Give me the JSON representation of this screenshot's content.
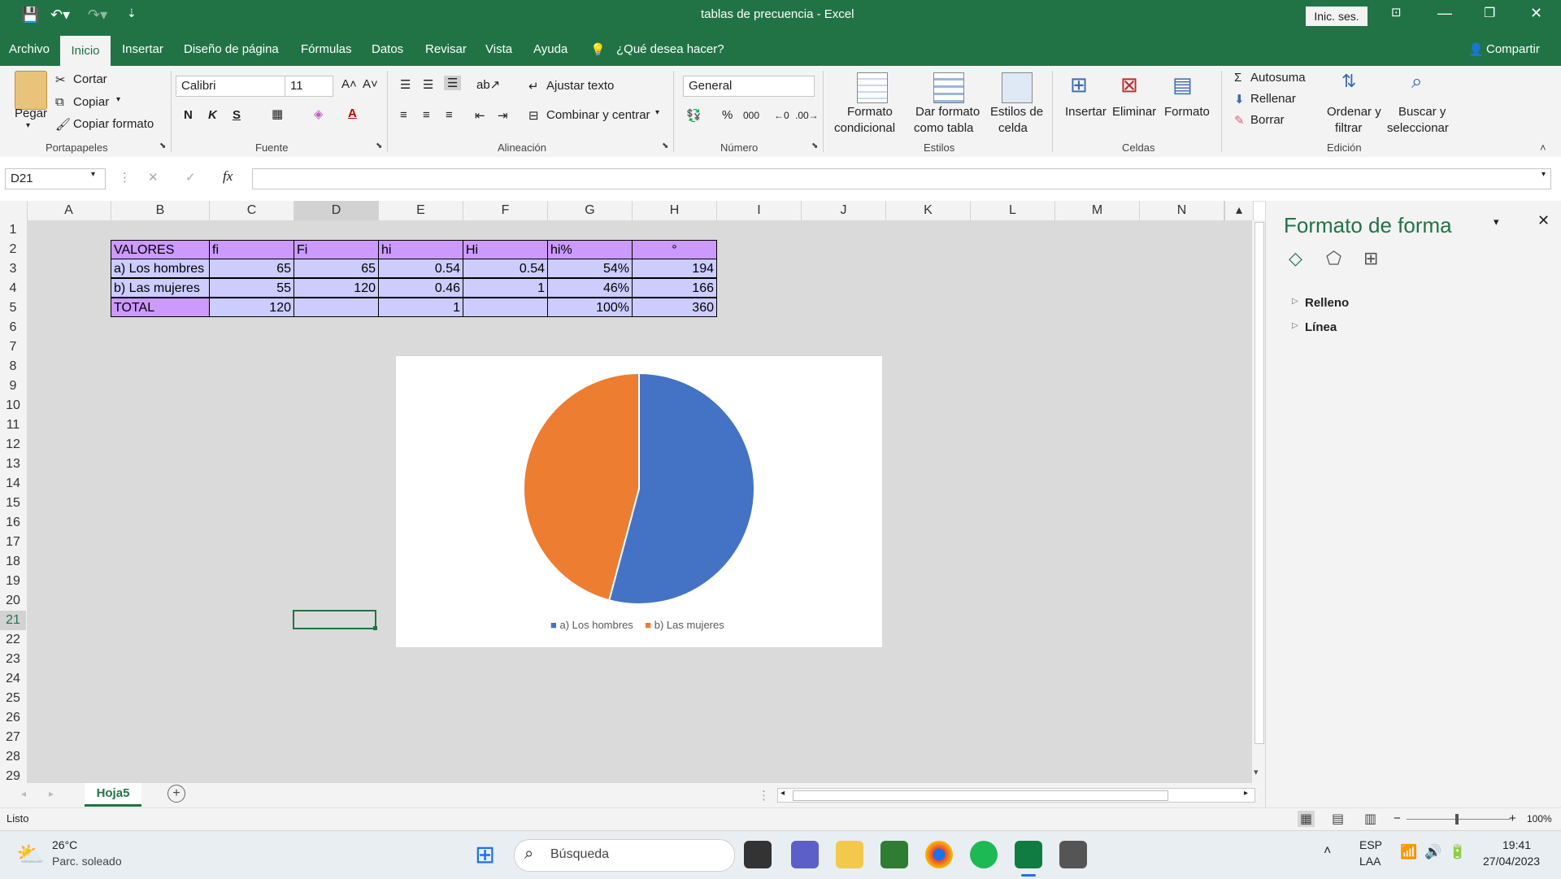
{
  "titlebar": {
    "title": "tablas de precuencia  -  Excel",
    "signin": "Inic. ses.",
    "minimize": "—",
    "restore": "❐",
    "close": "✕",
    "ribbon_toggle": "⊡"
  },
  "tabs": [
    "Archivo",
    "Inicio",
    "Insertar",
    "Diseño de página",
    "Fórmulas",
    "Datos",
    "Revisar",
    "Vista",
    "Ayuda"
  ],
  "tellme": "¿Qué desea hacer?",
  "share": "Compartir",
  "ribbon": {
    "clipboard": {
      "paste": "Pegar",
      "cut": "Cortar",
      "copy": "Copiar",
      "format_painter": "Copiar formato",
      "group": "Portapapeles"
    },
    "font": {
      "name": "Calibri",
      "size": "11",
      "bold": "N",
      "italic": "K",
      "underline": "S",
      "group": "Fuente"
    },
    "alignment": {
      "wrap": "Ajustar texto",
      "merge": "Combinar y centrar",
      "group": "Alineación"
    },
    "number": {
      "format": "General",
      "percent": "%",
      "thousands": "000",
      "group": "Número"
    },
    "styles": {
      "conditional": "Formato",
      "conditional2": "condicional",
      "table": "Dar formato",
      "table2": "como tabla",
      "cell": "Estilos de",
      "cell2": "celda",
      "group": "Estilos"
    },
    "cells": {
      "insert": "Insertar",
      "delete": "Eliminar",
      "format": "Formato",
      "group": "Celdas"
    },
    "editing": {
      "autosum": "Autosuma",
      "fill": "Rellenar",
      "clear": "Borrar",
      "sort": "Ordenar y",
      "sort2": "filtrar",
      "find": "Buscar y",
      "find2": "seleccionar",
      "group": "Edición"
    }
  },
  "formula_bar": {
    "namebox": "D21",
    "fx": "fx",
    "value": ""
  },
  "columns": [
    "A",
    "B",
    "C",
    "D",
    "E",
    "F",
    "G",
    "H",
    "I",
    "J",
    "K",
    "L",
    "M",
    "N"
  ],
  "rows": [
    "1",
    "2",
    "3",
    "4",
    "5",
    "6",
    "7",
    "8",
    "9",
    "10",
    "11",
    "12",
    "13",
    "14",
    "15",
    "16",
    "17",
    "18",
    "19",
    "20",
    "21",
    "22",
    "23",
    "24",
    "25",
    "26",
    "27",
    "28",
    "29"
  ],
  "table": {
    "header": [
      "VALORES",
      "fi",
      "Fi",
      "hi",
      "Hi",
      "hi%",
      "°"
    ],
    "rows": [
      [
        "a) Los hombres",
        "65",
        "65",
        "0.54",
        "0.54",
        "54%",
        "194"
      ],
      [
        "b) Las mujeres",
        "55",
        "120",
        "0.46",
        "1",
        "46%",
        "166"
      ],
      [
        "TOTAL",
        "120",
        "",
        "1",
        "",
        "100%",
        "360"
      ]
    ],
    "colors": {
      "header": "#cc99ff",
      "body": "#ccccff"
    }
  },
  "chart_data": {
    "type": "pie",
    "categories": [
      "a) Los hombres",
      "b) Las mujeres"
    ],
    "values": [
      65,
      55
    ],
    "colors": [
      "#4472c4",
      "#ed7d31"
    ],
    "title": "",
    "legend": "bottom"
  },
  "pane": {
    "title": "Formato de forma",
    "fill": "Relleno",
    "line": "Línea"
  },
  "sheets": {
    "active": "Hoja5",
    "add": "+"
  },
  "status": {
    "ready": "Listo",
    "zoom": "100%"
  },
  "taskbar": {
    "temp": "26°C",
    "weather": "Parc. soleado",
    "search": "Búsqueda",
    "lang1": "ESP",
    "lang2": "LAA",
    "time": "19:41",
    "date": "27/04/2023"
  }
}
